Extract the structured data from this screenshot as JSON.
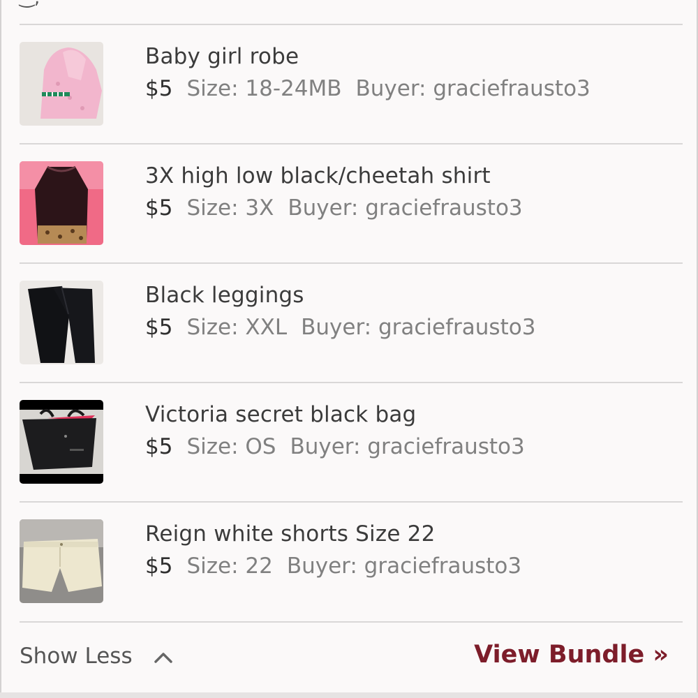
{
  "items": [
    {
      "title": "Baby girl robe",
      "price": "$5",
      "size": "Size: 18-24MB",
      "buyer": "Buyer: graciefrausto3"
    },
    {
      "title": "3X high low black/cheetah shirt",
      "price": "$5",
      "size": "Size: 3X",
      "buyer": "Buyer: graciefrausto3"
    },
    {
      "title": "Black leggings",
      "price": "$5",
      "size": "Size: XXL",
      "buyer": "Buyer: graciefrausto3"
    },
    {
      "title": "Victoria secret black bag",
      "price": "$5",
      "size": "Size: OS",
      "buyer": "Buyer: graciefrausto3"
    },
    {
      "title": "Reign white shorts Size 22",
      "price": "$5",
      "size": "Size: 22",
      "buyer": "Buyer: graciefrausto3"
    }
  ],
  "footer": {
    "show_less_label": "Show Less",
    "view_bundle_label": "View Bundle »"
  },
  "colors": {
    "accent": "#7d1d2a",
    "text": "#3b3b3b",
    "muted": "#808080",
    "divider": "#d9d7d7"
  },
  "icons": {
    "show_less": "chevron-up-icon"
  }
}
